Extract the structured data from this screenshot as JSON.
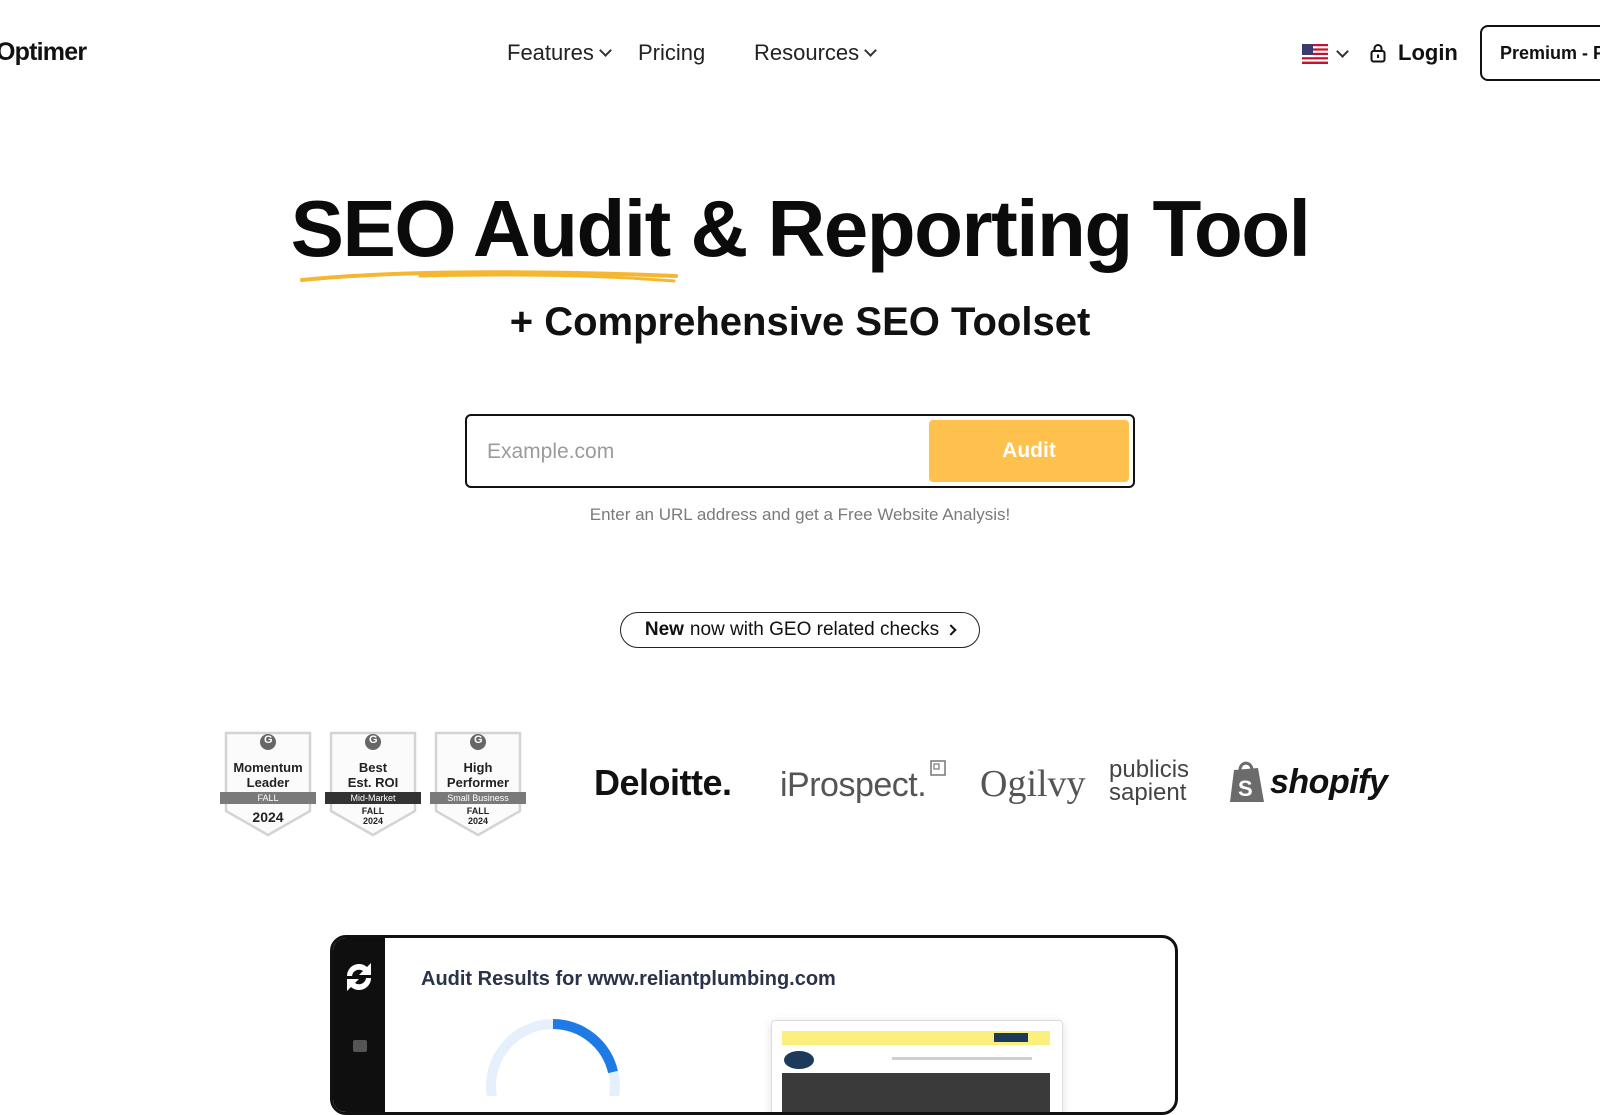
{
  "header": {
    "brand": "Optimer",
    "nav": [
      {
        "label": "Features",
        "dropdown": true
      },
      {
        "label": "Pricing",
        "dropdown": false
      },
      {
        "label": "Resources",
        "dropdown": true
      }
    ],
    "language_icon": "us-flag-icon",
    "login_label": "Login",
    "premium_label": "Premium - F"
  },
  "hero": {
    "title": "SEO Audit & Reporting Tool",
    "subtitle": "+ Comprehensive SEO Toolset",
    "search_placeholder": "Example.com",
    "audit_button": "Audit",
    "hint": "Enter an URL address and get a Free Website Analysis!",
    "announcement_bold": "New",
    "announcement_text": "now with GEO related checks"
  },
  "badges": [
    {
      "line1": "Momentum",
      "line2": "Leader",
      "ribbon": "FALL",
      "year": "2024"
    },
    {
      "line1": "Best",
      "line2": "Est. ROI",
      "ribbon": "Mid-Market",
      "season": "FALL",
      "year": "2024"
    },
    {
      "line1": "High",
      "line2": "Performer",
      "ribbon": "Small Business",
      "season": "FALL",
      "year": "2024"
    }
  ],
  "client_logos": {
    "deloitte": "Deloitte.",
    "iprospect": "iProspect.",
    "ogilvy": "Ogilvy",
    "publicis_line1": "publicis",
    "publicis_line2": "sapient",
    "shopify": "shopify"
  },
  "preview": {
    "title": "Audit Results for www.reliantplumbing.com"
  },
  "colors": {
    "accent": "#ffc14d",
    "underline": "#f5b731",
    "text": "#111111",
    "hint": "#7a7a7a"
  }
}
